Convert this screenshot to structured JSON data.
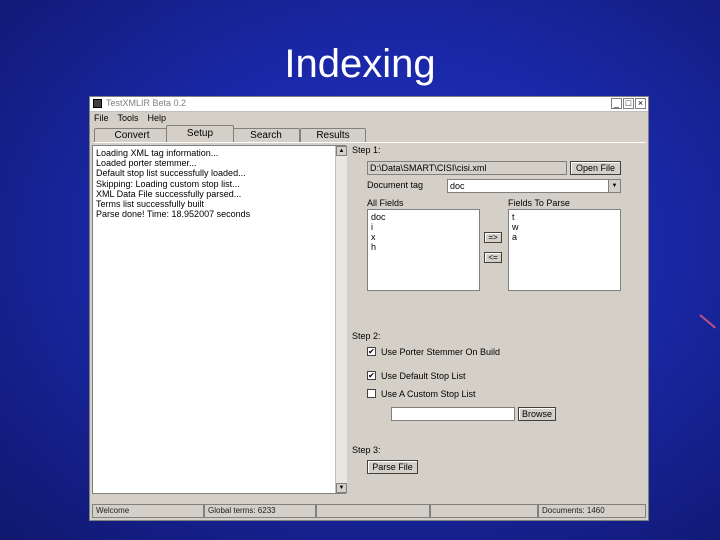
{
  "slide": {
    "title": "Indexing"
  },
  "window": {
    "title": "TestXMLIR Beta 0.2",
    "controls": {
      "minimize": "_",
      "maximize": "□",
      "close": "×"
    }
  },
  "menu": [
    "File",
    "Tools",
    "Help"
  ],
  "tabs": [
    "Convert",
    "Setup",
    "Search",
    "Results"
  ],
  "active_tab": "Setup",
  "log": [
    "Loading XML tag information...",
    "Loaded porter stemmer...",
    "Default stop list successfully loaded...",
    "Skipping: Loading custom stop list...",
    "XML Data File successfully parsed...",
    "Terms list successfully built",
    "Parse done! Time: 18.952007 seconds"
  ],
  "step1": {
    "heading": "Step 1:",
    "file_path": "D:\\Data\\SMART\\CISI\\cisi.xml",
    "open_button": "Open File",
    "doc_tag_label": "Document tag",
    "doc_tag_value": "doc",
    "all_fields_label": "All Fields",
    "all_fields": [
      "doc",
      "i",
      "x",
      "h"
    ],
    "fields_to_parse_label": "Fields To Parse",
    "fields_to_parse": [
      "t",
      "w",
      "a"
    ],
    "add_button": "=>",
    "remove_button": "<="
  },
  "step2": {
    "heading": "Step 2:",
    "options": [
      {
        "label": "Use Porter Stemmer On Build",
        "checked": true
      },
      {
        "label": "Use Default Stop List",
        "checked": true
      },
      {
        "label": "Use A Custom Stop List",
        "checked": false
      }
    ],
    "custom_path": "",
    "browse_button": "Browse"
  },
  "step3": {
    "heading": "Step 3:",
    "parse_button": "Parse File"
  },
  "status": {
    "message": "Welcome",
    "global_terms": "Global terms: 6233",
    "empty1": "",
    "empty2": "",
    "documents": "Documents: 1460"
  },
  "icons": {
    "check": "✔",
    "arrow_down": "▼",
    "arrow_up": "▲"
  }
}
